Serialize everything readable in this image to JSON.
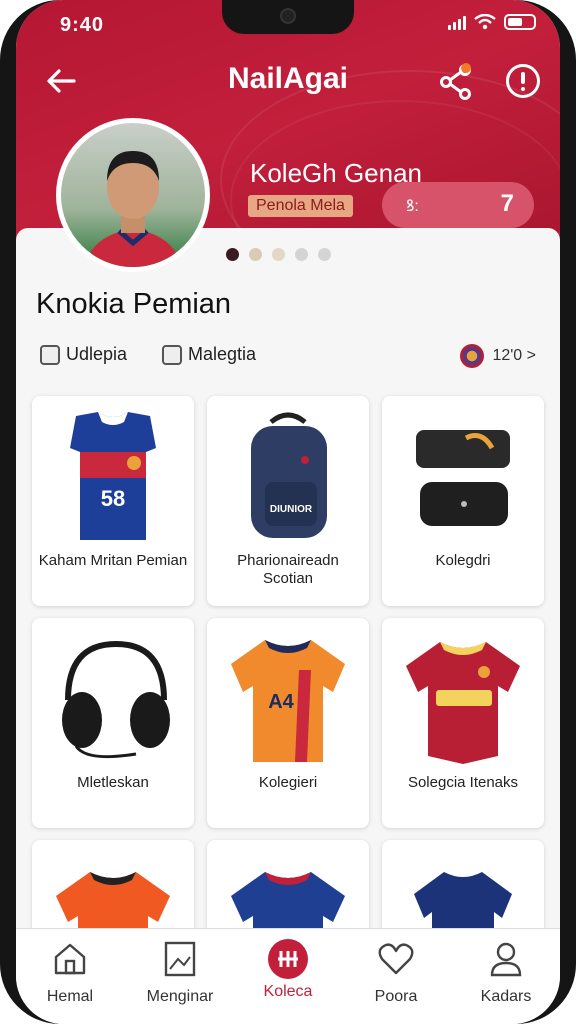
{
  "status_bar": {
    "time": "9:40"
  },
  "header": {
    "title": "NailAgai",
    "profile_name": "KoleGh Genan",
    "profile_tag": "Penola Mela",
    "stat_icon_text": "ꝸ:",
    "stat_value": "7"
  },
  "carousel": {
    "total": 5,
    "active": 0
  },
  "section": {
    "title": "Knokia Pemian",
    "filter1": "Udlepia",
    "filter2": "Malegtia",
    "count": "12'0 >"
  },
  "products": [
    {
      "label": "Kaham Mritan Pemian",
      "icon": "jersey-icon"
    },
    {
      "label": "Pharionaireadn Scotian",
      "icon": "backpack-icon"
    },
    {
      "label": "Kolegdri",
      "icon": "pouch-icon"
    },
    {
      "label": "Mletleskan",
      "icon": "headphones-icon"
    },
    {
      "label": "Kolegieri",
      "icon": "jersey-icon"
    },
    {
      "label": "Solegcia Itenaks",
      "icon": "jersey-icon"
    },
    {
      "label": "",
      "icon": "jersey-icon"
    },
    {
      "label": "",
      "icon": "jersey-icon"
    },
    {
      "label": "",
      "icon": "jersey-icon"
    }
  ],
  "nav": [
    {
      "label": "Hemal",
      "icon": "home-icon"
    },
    {
      "label": "Menginar",
      "icon": "image-icon"
    },
    {
      "label": "Koleca",
      "icon": "collection-icon"
    },
    {
      "label": "Poora",
      "icon": "heart-icon"
    },
    {
      "label": "Kadars",
      "icon": "profile-icon"
    }
  ],
  "colors": {
    "brand": "#c21f3b",
    "accent_pill": "#d6536a"
  }
}
